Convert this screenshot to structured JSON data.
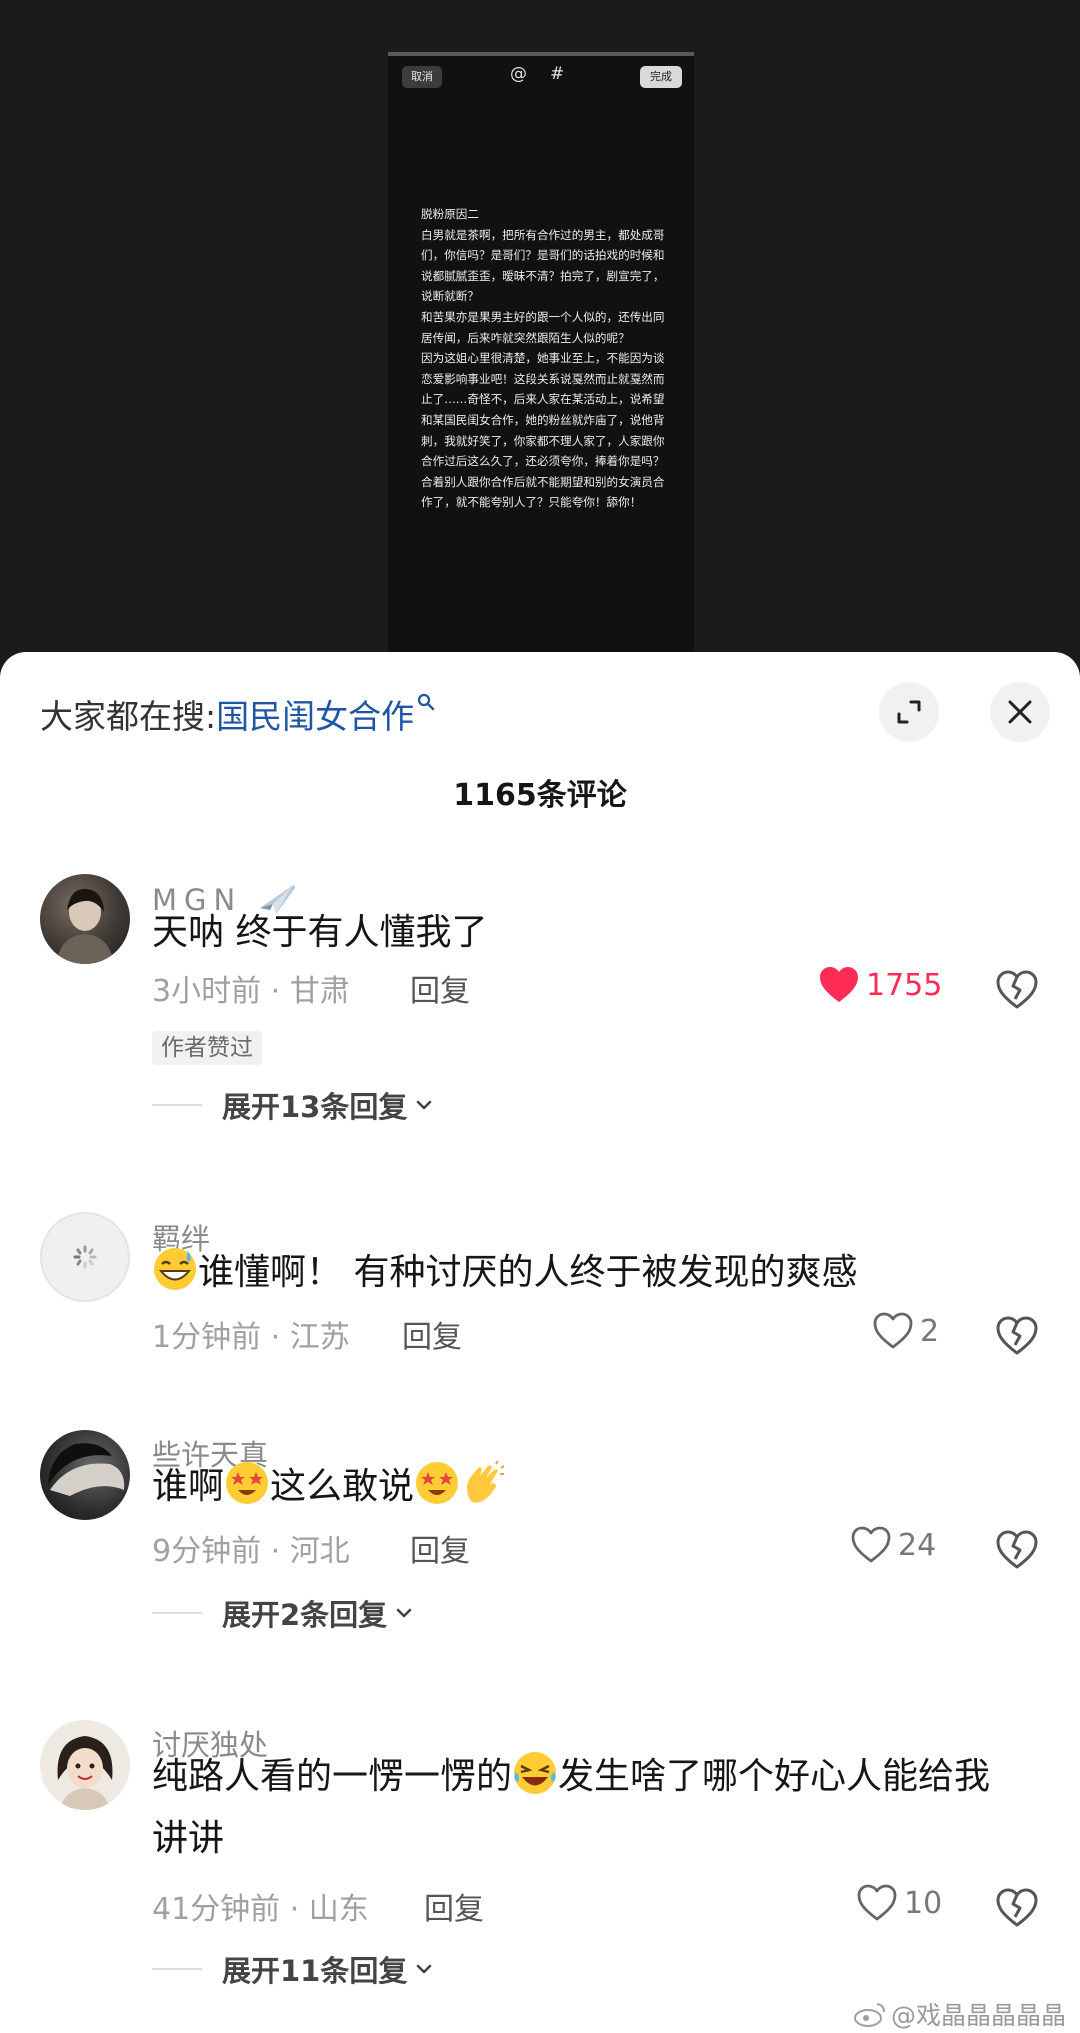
{
  "video": {
    "cancel_label": "取消",
    "at_label": "@",
    "hash_label": "#",
    "done_label": "完成",
    "note_text": "脱粉原因二\n白男就是茶啊，把所有合作过的男主，都处成哥们，你信吗？是哥们？是哥们的话拍戏的时候和说都腻腻歪歪，暧昧不清？拍完了，剧宣完了，说断就断？\n和苦果亦是果男主好的跟一个人似的，还传出同居传闻，后来咋就突然跟陌生人似的呢？\n因为这姐心里很清楚，她事业至上，不能因为谈恋爱影响事业吧！这段关系说戛然而止就戛然而止了……奇怪不，后来人家在某活动上，说希望和某国民闺女合作，她的粉丝就炸庙了，说他背刺，我就好笑了，你家都不理人家了，人家跟你合作过后这么久了，还必须夸你，捧着你是吗？合着别人跟你合作后就不能期望和别的女演员合作了，就不能夸别人了？只能夸你！舔你！"
  },
  "sheet": {
    "search_prefix": "大家都在搜:",
    "search_term": "国民闺女合作",
    "comment_count": "1165条评论"
  },
  "comments": [
    {
      "username": "MGN",
      "text": "天呐 终于有人懂我了",
      "time_location": "3小时前 · 甘肃",
      "reply_label": "回复",
      "likes": "1755",
      "liked": true,
      "badge": "作者赞过",
      "expand_label": "展开13条回复"
    },
    {
      "username": "羁绊",
      "text_after_emoji": "谁懂啊！ 有种讨厌的人终于被发现的爽感",
      "time_location": "1分钟前 · 江苏",
      "reply_label": "回复",
      "likes": "2",
      "liked": false
    },
    {
      "username": "些许天真",
      "text_part1": "谁啊",
      "text_part2": "这么敢说",
      "time_location": "9分钟前 · 河北",
      "reply_label": "回复",
      "likes": "24",
      "liked": false,
      "expand_label": "展开2条回复"
    },
    {
      "username": "讨厌独处",
      "text_part1": "纯路人看的一愣一愣的",
      "text_part2": "发生啥了哪个好心人能给我讲讲",
      "time_location": "41分钟前 · 山东",
      "reply_label": "回复",
      "likes": "10",
      "liked": false,
      "expand_label": "展开11条回复"
    }
  ],
  "watermark": "@戏晶晶晶晶晶",
  "colors": {
    "like_active": "#fe2c55",
    "link_blue": "#1f56a3",
    "sheet_bg": "#ffffff",
    "video_bg": "#1b1b1b"
  }
}
